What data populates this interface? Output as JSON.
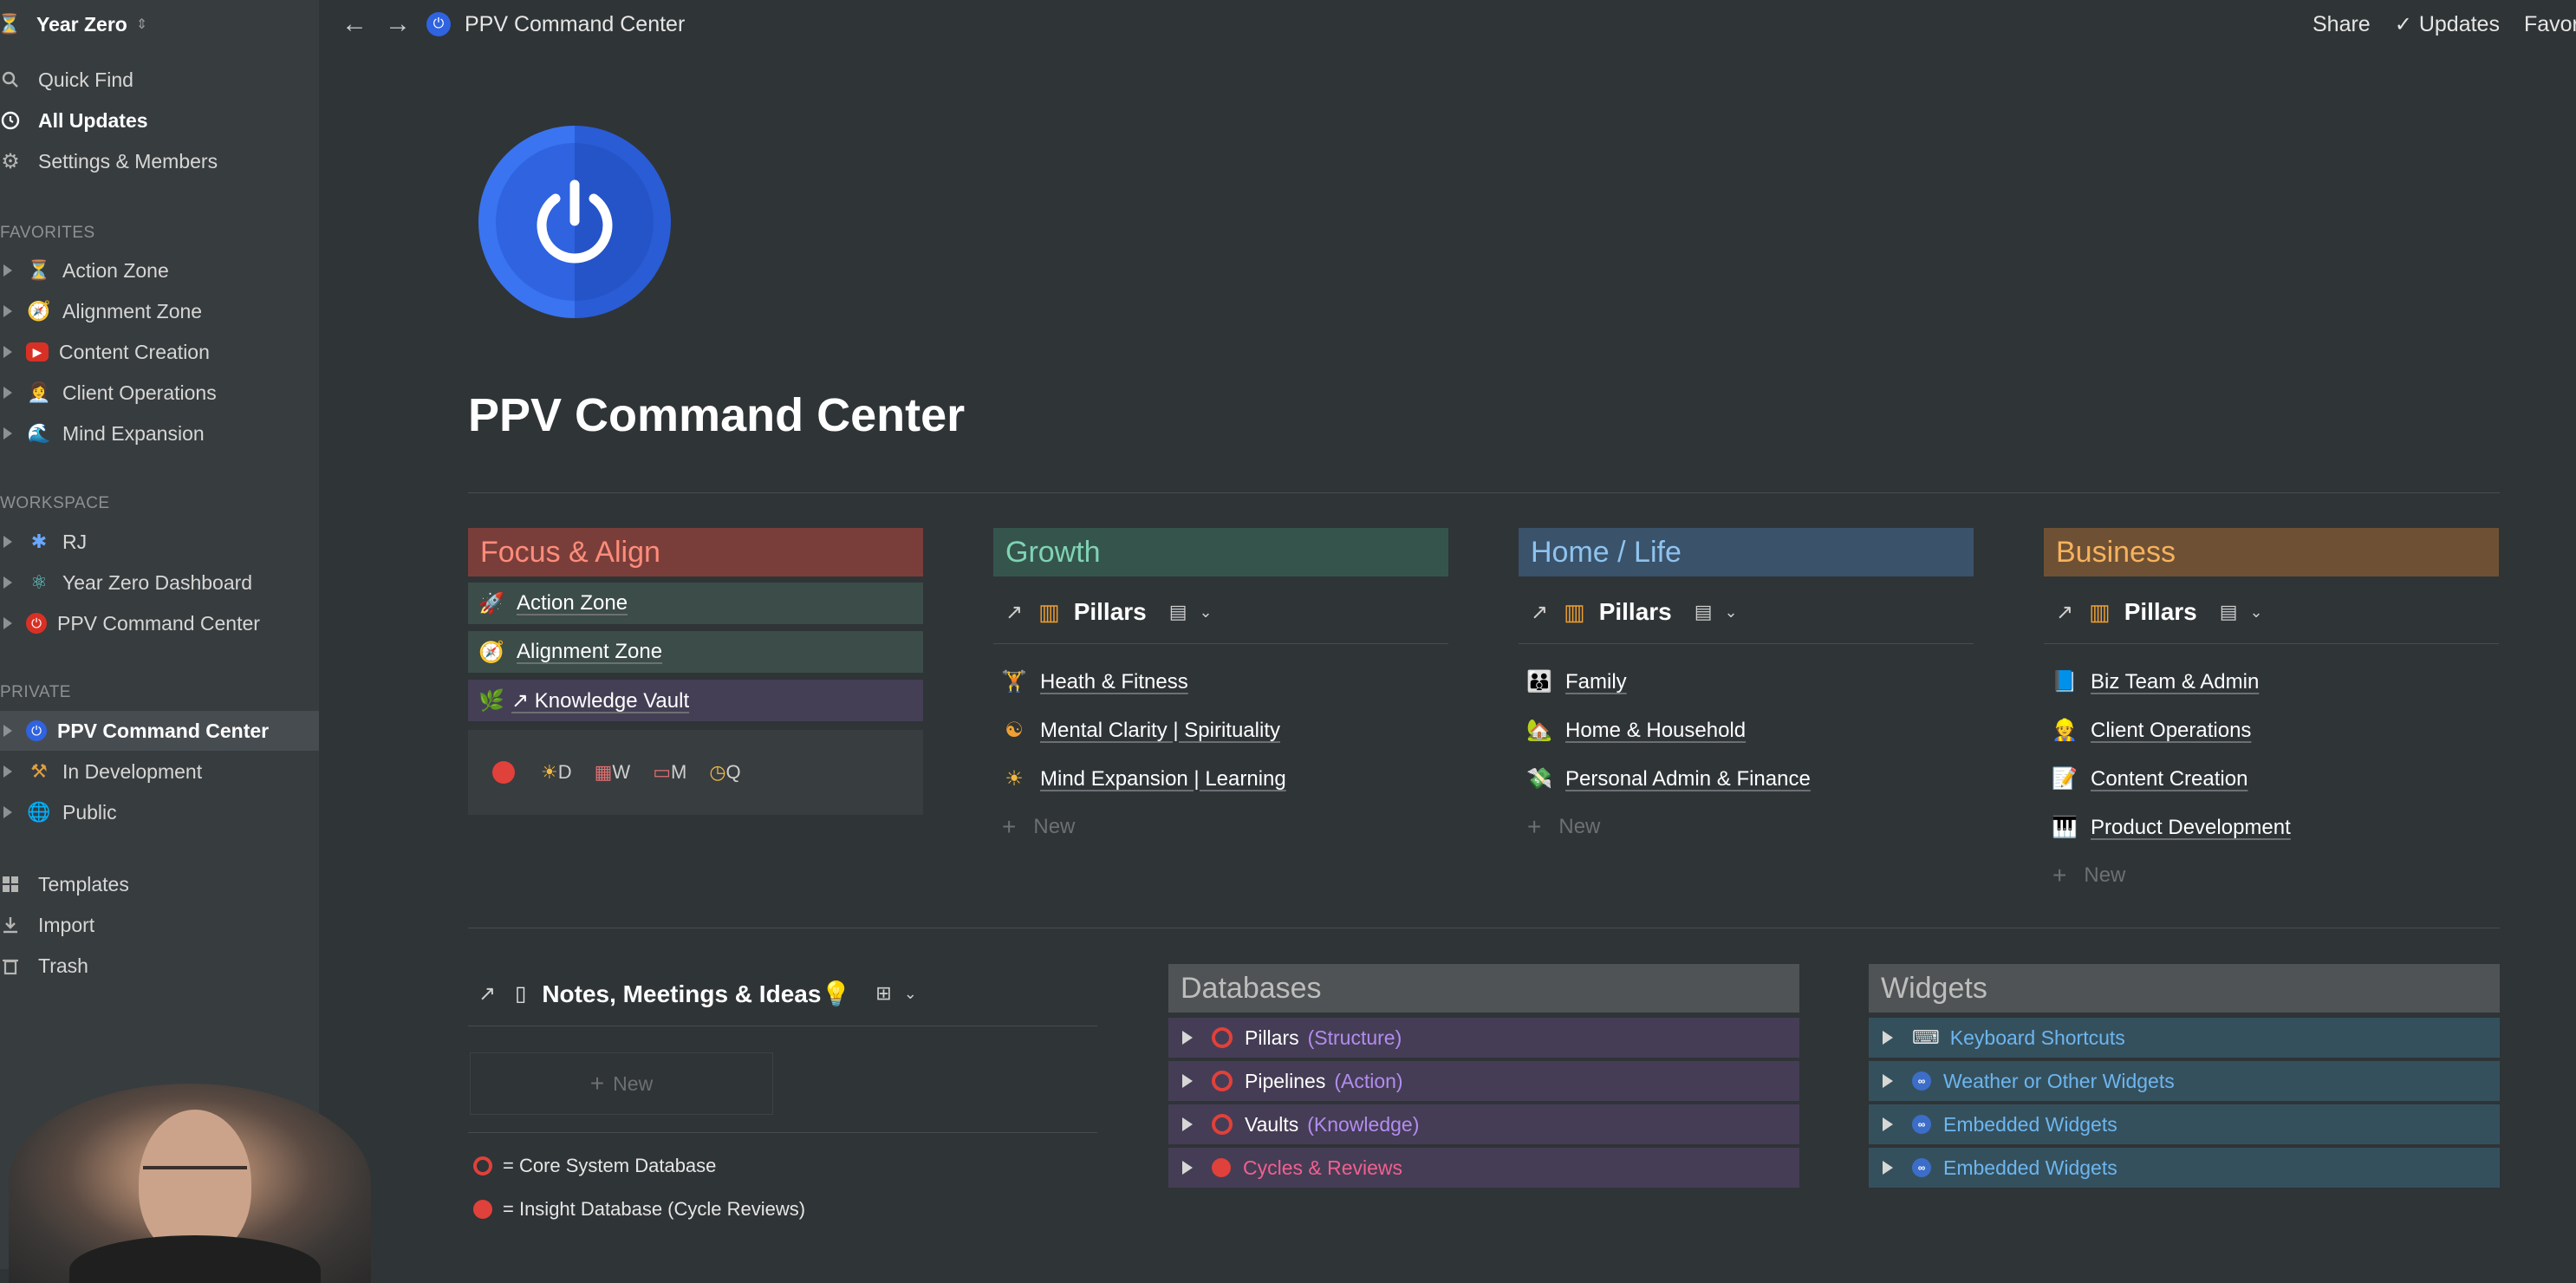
{
  "workspace": {
    "name": "Year Zero"
  },
  "sidebar": {
    "nav": [
      {
        "label": "Quick Find",
        "icon": "search-icon"
      },
      {
        "label": "All Updates",
        "icon": "clock-icon"
      },
      {
        "label": "Settings & Members",
        "icon": "gear-icon"
      }
    ],
    "favorites_title": "FAVORITES",
    "favorites": [
      {
        "label": "Action Zone",
        "icon": "⏳"
      },
      {
        "label": "Alignment Zone",
        "icon": "🧭"
      },
      {
        "label": "Content Creation",
        "icon": "▶"
      },
      {
        "label": "Client Operations",
        "icon": "👩‍💼"
      },
      {
        "label": "Mind Expansion",
        "icon": "🌊"
      }
    ],
    "workspace_title": "WORKSPACE",
    "workspace_items": [
      {
        "label": "RJ",
        "icon": "✱"
      },
      {
        "label": "Year Zero Dashboard",
        "icon": "⚛"
      },
      {
        "label": "PPV Command Center",
        "icon": "⏻"
      }
    ],
    "private_title": "PRIVATE",
    "private_items": [
      {
        "label": "PPV Command Center",
        "icon": "⏻"
      },
      {
        "label": "In Development",
        "icon": "⚒"
      },
      {
        "label": "Public",
        "icon": "🌐"
      }
    ],
    "bottom": [
      {
        "label": "Templates",
        "icon": "templates-icon"
      },
      {
        "label": "Import",
        "icon": "import-icon"
      },
      {
        "label": "Trash",
        "icon": "trash-icon"
      }
    ]
  },
  "topbar": {
    "title": "PPV Command Center",
    "share": "Share",
    "updates": "Updates",
    "favorite": "Favorite"
  },
  "page": {
    "title": "PPV Command Center"
  },
  "focus": {
    "title": "Focus & Align",
    "items": [
      {
        "label": "Action Zone",
        "icon": "🚀"
      },
      {
        "label": "Alignment Zone",
        "icon": "🧭"
      },
      {
        "label": "↗ Knowledge Vault",
        "icon": "🌿"
      }
    ],
    "cycles": [
      "D",
      "W",
      "M",
      "Q"
    ]
  },
  "columns": [
    {
      "title": "Growth",
      "pillars": "Pillars",
      "items": [
        {
          "label": "Heath & Fitness",
          "icon": "🏋"
        },
        {
          "label": "Mental Clarity | Spirituality",
          "icon": "☯"
        },
        {
          "label": "Mind Expansion | Learning",
          "icon": "☀"
        }
      ],
      "new": "New"
    },
    {
      "title": "Home / Life",
      "pillars": "Pillars",
      "items": [
        {
          "label": "Family",
          "icon": "👪"
        },
        {
          "label": "Home & Household",
          "icon": "🏡"
        },
        {
          "label": "Personal Admin & Finance",
          "icon": "💸"
        }
      ],
      "new": "New"
    },
    {
      "title": "Business",
      "pillars": "Pillars",
      "items": [
        {
          "label": "Biz Team & Admin",
          "icon": "📘"
        },
        {
          "label": "Client Operations",
          "icon": "👷"
        },
        {
          "label": "Content Creation",
          "icon": "📝"
        },
        {
          "label": "Product Development",
          "icon": "🎹"
        }
      ],
      "new": "New"
    }
  ],
  "notes": {
    "title": "Notes, Meetings & Ideas💡",
    "new": "New",
    "legend": [
      "= Core System Database",
      "= Insight Database (Cycle Reviews)"
    ]
  },
  "databases": {
    "title": "Databases",
    "rows": [
      {
        "name": "Pillars",
        "tag": "(Structure)"
      },
      {
        "name": "Pipelines",
        "tag": "(Action)"
      },
      {
        "name": "Vaults",
        "tag": "(Knowledge)"
      },
      {
        "name": "Cycles & Reviews",
        "tag": ""
      }
    ]
  },
  "widgets": {
    "title": "Widgets",
    "rows": [
      "Keyboard Shortcuts",
      "Weather or Other Widgets",
      "Embedded Widgets",
      "Embedded Widgets"
    ]
  },
  "colors": {
    "focus_header": "#7a3e3a",
    "growth_header": "#35554c",
    "home_header": "#3a526a",
    "business_header": "#6e5135",
    "db_row": "#453d55",
    "widget_row": "#35505d",
    "gray_header": "#4f5356"
  }
}
